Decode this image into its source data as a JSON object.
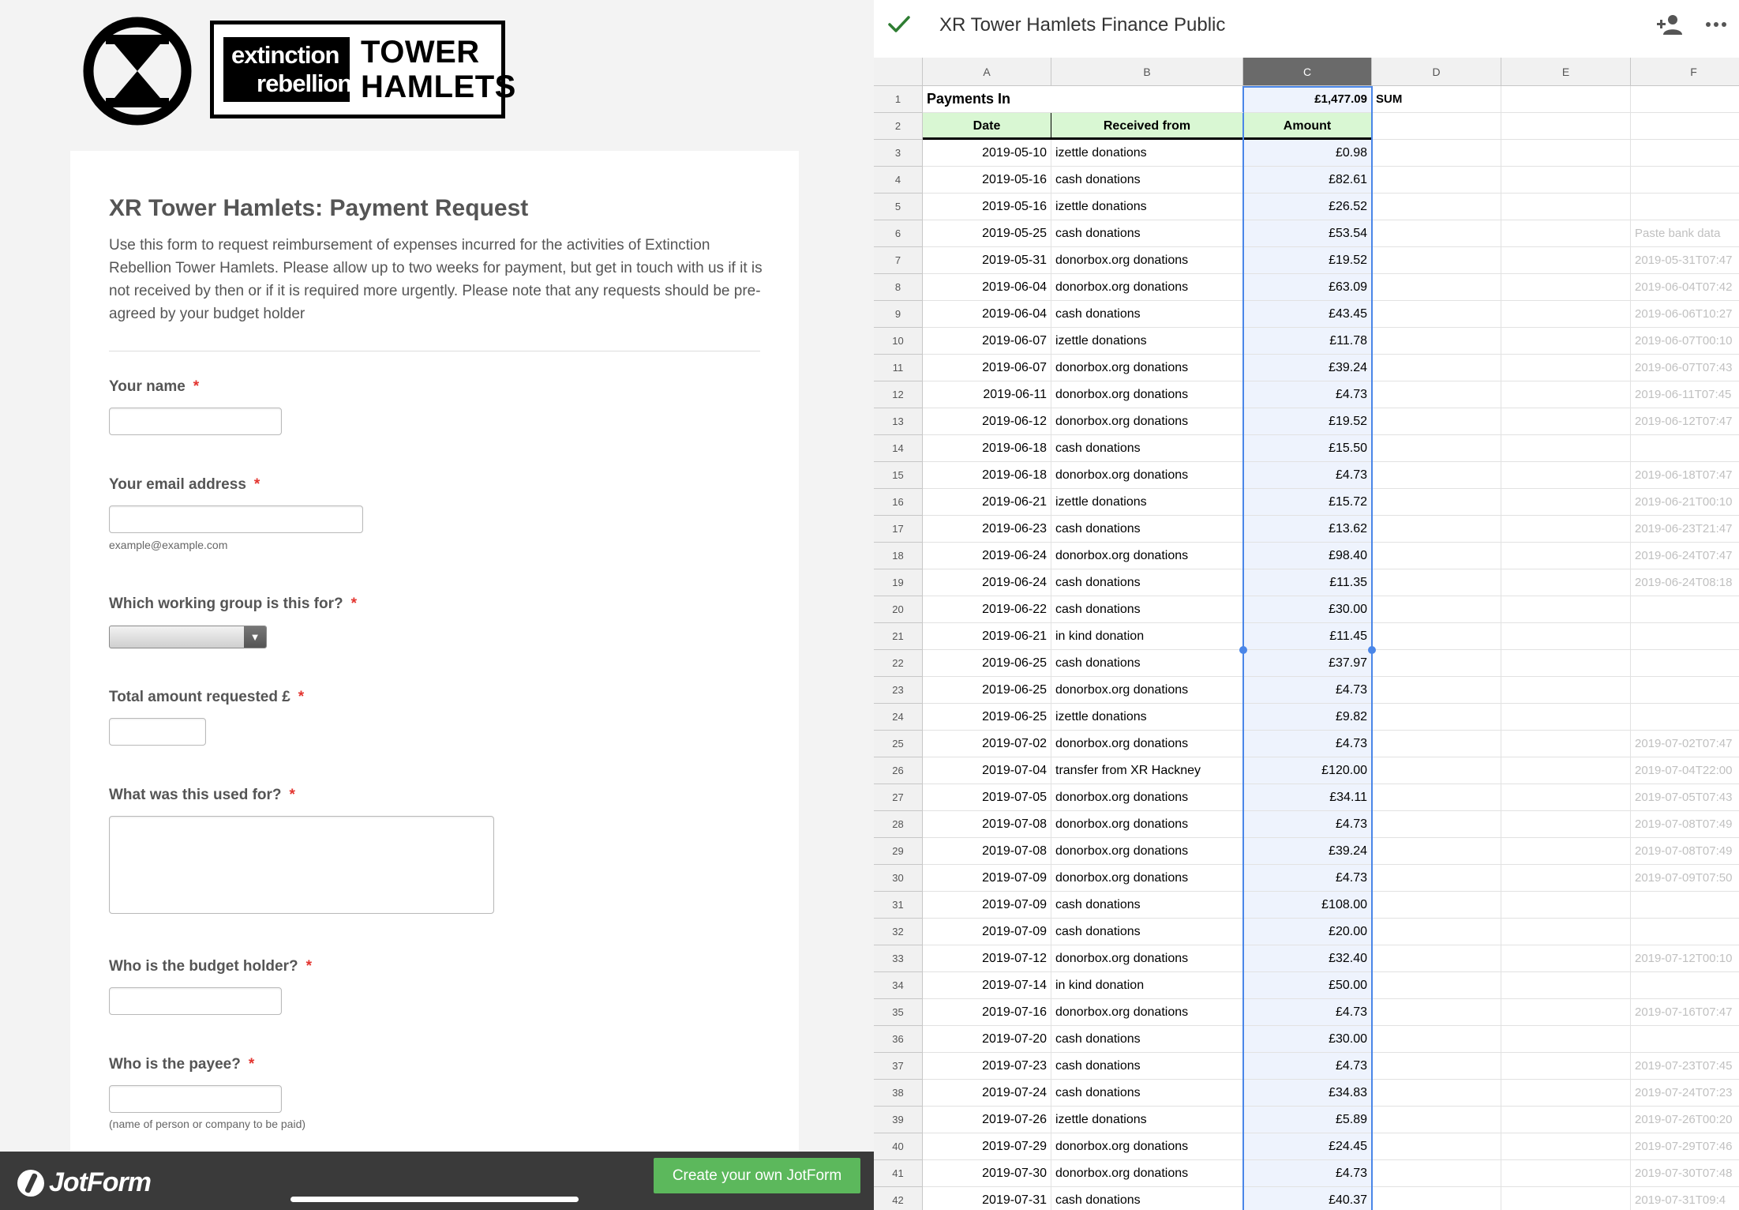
{
  "jotform": {
    "brand": {
      "left_line1": "extinction",
      "left_line2": "rebellion",
      "right_line1": "TOWER",
      "right_line2": "HAMLETS"
    },
    "title": "XR Tower Hamlets: Payment Request",
    "description": "Use this form to request reimbursement of expenses incurred for the activities of Extinction Rebellion Tower Hamlets. Please allow up to two weeks for payment, but get in touch with us if it is not received by then or if it is required more urgently. Please note that any requests should be pre-agreed by your budget holder",
    "required_mark": "*",
    "questions": {
      "name": {
        "label": "Your name",
        "value": ""
      },
      "email": {
        "label": "Your email address",
        "value": "",
        "hint": "example@example.com"
      },
      "group": {
        "label": "Which working group is this for?",
        "value": ""
      },
      "amount": {
        "label": "Total amount requested £",
        "value": ""
      },
      "used_for": {
        "label": "What was this used for?",
        "value": ""
      },
      "budget_holder": {
        "label": "Who is the budget holder?",
        "value": ""
      },
      "payee": {
        "label": "Who is the payee?",
        "value": "",
        "hint": "(name of person or company to be paid)"
      }
    },
    "footer": {
      "logo_text": "JotForm",
      "create_button": "Create your own JotForm"
    }
  },
  "sheet": {
    "title": "XR Tower Hamlets Finance Public",
    "icons": {
      "saved": "check-icon",
      "share": "add-person-icon",
      "menu": "more-icon"
    },
    "colors": {
      "header_green": "#d9f7d3",
      "selection_blue": "#4a86e8",
      "saved_check": "#2e7d32"
    },
    "columns": [
      "A",
      "B",
      "C",
      "D",
      "E",
      "F"
    ],
    "selected_column": "C",
    "row1": {
      "label": "Payments In",
      "sum_value": "£1,477.09",
      "sum_label": "SUM"
    },
    "header_row": {
      "date": "Date",
      "received_from": "Received from",
      "amount": "Amount"
    },
    "rows": [
      {
        "n": "3",
        "date": "2019-05-10",
        "from": "izettle donations",
        "amount": "£0.98",
        "f": ""
      },
      {
        "n": "4",
        "date": "2019-05-16",
        "from": "cash donations",
        "amount": "£82.61",
        "f": ""
      },
      {
        "n": "5",
        "date": "2019-05-16",
        "from": "izettle donations",
        "amount": "£26.52",
        "f": ""
      },
      {
        "n": "6",
        "date": "2019-05-25",
        "from": "cash donations",
        "amount": "£53.54",
        "f": "Paste bank data"
      },
      {
        "n": "7",
        "date": "2019-05-31",
        "from": "donorbox.org donations",
        "amount": "£19.52",
        "f": "2019-05-31T07:47"
      },
      {
        "n": "8",
        "date": "2019-06-04",
        "from": "donorbox.org donations",
        "amount": "£63.09",
        "f": "2019-06-04T07:42"
      },
      {
        "n": "9",
        "date": "2019-06-04",
        "from": "cash donations",
        "amount": "£43.45",
        "f": "2019-06-06T10:27"
      },
      {
        "n": "10",
        "date": "2019-06-07",
        "from": "izettle donations",
        "amount": "£11.78",
        "f": "2019-06-07T00:10"
      },
      {
        "n": "11",
        "date": "2019-06-07",
        "from": "donorbox.org donations",
        "amount": "£39.24",
        "f": "2019-06-07T07:43"
      },
      {
        "n": "12",
        "date": "2019-06-11",
        "from": "donorbox.org donations",
        "amount": "£4.73",
        "f": "2019-06-11T07:45"
      },
      {
        "n": "13",
        "date": "2019-06-12",
        "from": "donorbox.org donations",
        "amount": "£19.52",
        "f": "2019-06-12T07:47"
      },
      {
        "n": "14",
        "date": "2019-06-18",
        "from": "cash donations",
        "amount": "£15.50",
        "f": ""
      },
      {
        "n": "15",
        "date": "2019-06-18",
        "from": "donorbox.org donations",
        "amount": "£4.73",
        "f": "2019-06-18T07:47"
      },
      {
        "n": "16",
        "date": "2019-06-21",
        "from": "izettle donations",
        "amount": "£15.72",
        "f": "2019-06-21T00:10"
      },
      {
        "n": "17",
        "date": "2019-06-23",
        "from": "cash donations",
        "amount": "£13.62",
        "f": "2019-06-23T21:47"
      },
      {
        "n": "18",
        "date": "2019-06-24",
        "from": "donorbox.org donations",
        "amount": "£98.40",
        "f": "2019-06-24T07:47"
      },
      {
        "n": "19",
        "date": "2019-06-24",
        "from": "cash donations",
        "amount": "£11.35",
        "f": "2019-06-24T08:18"
      },
      {
        "n": "20",
        "date": "2019-06-22",
        "from": "cash donations",
        "amount": "£30.00",
        "f": ""
      },
      {
        "n": "21",
        "date": "2019-06-21",
        "from": "in kind donation",
        "amount": "£11.45",
        "f": ""
      },
      {
        "n": "22",
        "date": "2019-06-25",
        "from": "cash donations",
        "amount": "£37.97",
        "f": ""
      },
      {
        "n": "23",
        "date": "2019-06-25",
        "from": "donorbox.org donations",
        "amount": "£4.73",
        "f": ""
      },
      {
        "n": "24",
        "date": "2019-06-25",
        "from": "izettle donations",
        "amount": "£9.82",
        "f": ""
      },
      {
        "n": "25",
        "date": "2019-07-02",
        "from": "donorbox.org donations",
        "amount": "£4.73",
        "f": "2019-07-02T07:47"
      },
      {
        "n": "26",
        "date": "2019-07-04",
        "from": "transfer from XR Hackney",
        "amount": "£120.00",
        "f": "2019-07-04T22:00"
      },
      {
        "n": "27",
        "date": "2019-07-05",
        "from": "donorbox.org donations",
        "amount": "£34.11",
        "f": "2019-07-05T07:43"
      },
      {
        "n": "28",
        "date": "2019-07-08",
        "from": "donorbox.org donations",
        "amount": "£4.73",
        "f": "2019-07-08T07:49"
      },
      {
        "n": "29",
        "date": "2019-07-08",
        "from": "donorbox.org donations",
        "amount": "£39.24",
        "f": "2019-07-08T07:49"
      },
      {
        "n": "30",
        "date": "2019-07-09",
        "from": "donorbox.org donations",
        "amount": "£4.73",
        "f": "2019-07-09T07:50"
      },
      {
        "n": "31",
        "date": "2019-07-09",
        "from": "cash donations",
        "amount": "£108.00",
        "f": ""
      },
      {
        "n": "32",
        "date": "2019-07-09",
        "from": "cash donations",
        "amount": "£20.00",
        "f": ""
      },
      {
        "n": "33",
        "date": "2019-07-12",
        "from": "donorbox.org donations",
        "amount": "£32.40",
        "f": "2019-07-12T00:10"
      },
      {
        "n": "34",
        "date": "2019-07-14",
        "from": "in kind donation",
        "amount": "£50.00",
        "f": ""
      },
      {
        "n": "35",
        "date": "2019-07-16",
        "from": "donorbox.org donations",
        "amount": "£4.73",
        "f": "2019-07-16T07:47"
      },
      {
        "n": "36",
        "date": "2019-07-20",
        "from": "cash donations",
        "amount": "£30.00",
        "f": ""
      },
      {
        "n": "37",
        "date": "2019-07-23",
        "from": "cash donations",
        "amount": "£4.73",
        "f": "2019-07-23T07:45"
      },
      {
        "n": "38",
        "date": "2019-07-24",
        "from": "cash donations",
        "amount": "£34.83",
        "f": "2019-07-24T07:23"
      },
      {
        "n": "39",
        "date": "2019-07-26",
        "from": "izettle donations",
        "amount": "£5.89",
        "f": "2019-07-26T00:20"
      },
      {
        "n": "40",
        "date": "2019-07-29",
        "from": "donorbox.org donations",
        "amount": "£24.45",
        "f": "2019-07-29T07:46"
      },
      {
        "n": "41",
        "date": "2019-07-30",
        "from": "donorbox.org donations",
        "amount": "£4.73",
        "f": "2019-07-30T07:48"
      },
      {
        "n": "42",
        "date": "2019-07-31",
        "from": "cash donations",
        "amount": "£40.37",
        "f": "2019-07-31T09:4"
      }
    ]
  }
}
